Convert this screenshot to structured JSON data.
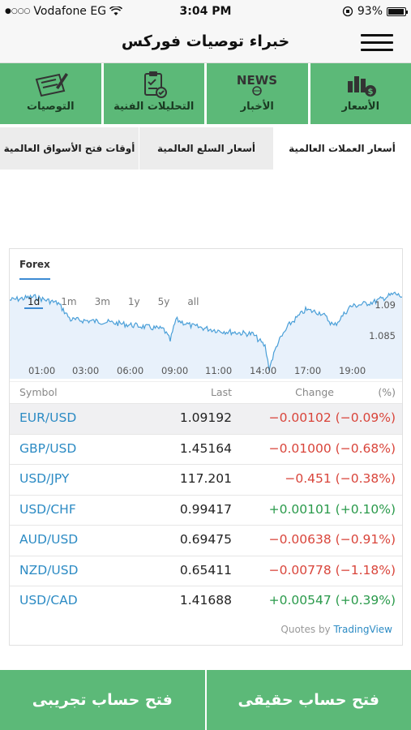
{
  "status_bar": {
    "carrier": "Vodafone EG",
    "signal_dots": "●○○○",
    "time": "3:04 PM",
    "battery": "93%"
  },
  "nav": {
    "title": "خبراء توصيات فوركس"
  },
  "tiles": [
    {
      "label": "الأسعار",
      "icon": "prices-chart-icon"
    },
    {
      "label": "الأخبار",
      "icon": "news-icon",
      "icon_text": "NEWS"
    },
    {
      "label": "التحليلات الفنية",
      "icon": "clipboard-check-icon"
    },
    {
      "label": "التوصيات",
      "icon": "pen-paper-icon"
    }
  ],
  "subtabs": [
    "أسعار العملات العالمية",
    "أسعار السلع العالمية",
    "أوقات فتح الأسواق العالمية"
  ],
  "widget": {
    "tab": "Forex",
    "ranges": [
      "1d",
      "1m",
      "3m",
      "1y",
      "5y",
      "all"
    ],
    "selected_range": "1d",
    "y_labels": [
      "1.09",
      "1.085"
    ],
    "times": [
      "01:00",
      "03:00",
      "06:00",
      "09:00",
      "11:00",
      "14:00",
      "17:00",
      "19:00"
    ],
    "headers": {
      "symbol": "Symbol",
      "last": "Last",
      "change": "Change",
      "pct": "(%)"
    },
    "rows": [
      {
        "symbol": "EUR/USD",
        "last": "1.09192",
        "change": "−0.00102 (−0.09%)",
        "dir": "neg"
      },
      {
        "symbol": "GBP/USD",
        "last": "1.45164",
        "change": "−0.01000 (−0.68%)",
        "dir": "neg"
      },
      {
        "symbol": "USD/JPY",
        "last": "117.201",
        "change": "−0.451 (−0.38%)",
        "dir": "neg"
      },
      {
        "symbol": "USD/CHF",
        "last": "0.99417",
        "change": "+0.00101 (+0.10%)",
        "dir": "pos"
      },
      {
        "symbol": "AUD/USD",
        "last": "0.69475",
        "change": "−0.00638 (−0.91%)",
        "dir": "neg"
      },
      {
        "symbol": "NZD/USD",
        "last": "0.65411",
        "change": "−0.00778 (−1.18%)",
        "dir": "neg"
      },
      {
        "symbol": "USD/CAD",
        "last": "1.41688",
        "change": "+0.00547 (+0.39%)",
        "dir": "pos"
      }
    ],
    "credit_prefix": "Quotes by",
    "credit_brand": "TradingView"
  },
  "buttons": {
    "real": "فتح حساب حقيقى",
    "demo": "فتح حساب تجريبى"
  },
  "colors": {
    "green": "#5cb978",
    "blue": "#2c8bc4",
    "negative": "#d9453b",
    "positive": "#2a9a4b"
  }
}
